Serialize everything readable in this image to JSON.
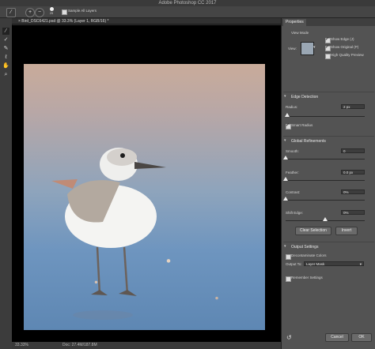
{
  "app": {
    "title": "Adobe Photoshop CC 2017"
  },
  "options_bar": {
    "brush_size": "25",
    "sample_all_layers": "Sample All Layers"
  },
  "document": {
    "tab_title": "× Bird_DSC6421.psd @ 33.3% (Layer 1, RGB/16) *"
  },
  "status": {
    "zoom": "33.33%",
    "doc": "Doc: 27.4M/187.8M"
  },
  "properties": {
    "tab": "Properties",
    "view_mode": {
      "heading": "View Mode",
      "view_label": "View:",
      "show_edge": "Show Edge (J)",
      "show_original": "Show Original (P)",
      "high_quality": "High Quality Preview"
    },
    "edge_detection": {
      "heading": "Edge Detection",
      "radius_label": "Radius:",
      "radius_value": "2 px",
      "radius_fraction": 0.02,
      "smart_radius": "Smart Radius"
    },
    "global_refinements": {
      "heading": "Global Refinements",
      "smooth_label": "Smooth:",
      "smooth_value": "0",
      "feather_label": "Feather:",
      "feather_value": "0.0 px",
      "contrast_label": "Contrast:",
      "contrast_value": "0%",
      "shift_edge_label": "Shift Edge:",
      "shift_edge_value": "0%",
      "clear_selection": "Clear Selection",
      "invert": "Invert"
    },
    "output_settings": {
      "heading": "Output Settings",
      "decontaminate": "Decontaminate Colors",
      "output_to_label": "Output To:",
      "output_to_value": "Layer Mask",
      "remember": "Remember Settings"
    },
    "cancel": "Cancel",
    "ok": "OK"
  },
  "colors": {
    "panel": "#535353",
    "canvas": "#000000",
    "toolbar": "#3c3c3c"
  }
}
